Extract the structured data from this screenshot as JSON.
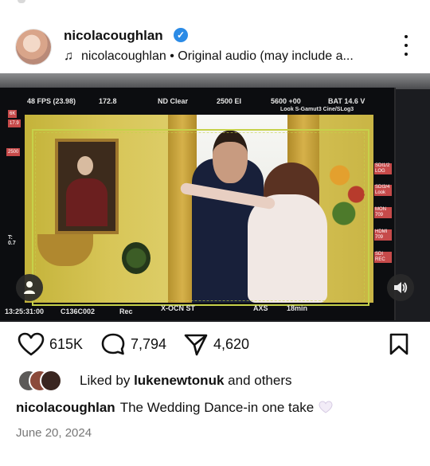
{
  "post": {
    "username": "nicolacoughlan",
    "audio_text": "nicolacoughlan • Original audio (may include a...",
    "likes": "615K",
    "comments": "7,794",
    "shares": "4,620",
    "liked_by_prefix": "Liked by",
    "liked_by_user": "lukenewtonuk",
    "liked_by_suffix": "and others",
    "caption_user": "nicolacoughlan",
    "caption_text": "The Wedding Dance-in one take",
    "date": "June 20, 2024"
  },
  "monitor": {
    "fps": "48 FPS (23.98)",
    "angle": "172.8",
    "nd": "ND Clear",
    "ei": "2500 EI",
    "wb": "5600 +00",
    "bat": "BAT 14.6 V",
    "look": "Look S-Gamut3 Cine/SLog3",
    "res": "6K",
    "res_num": "17.9",
    "iso_side": "2500",
    "t_stop": "T: 0.7",
    "timecode": "13:25:31:00",
    "clip": "C136C002",
    "rec": "Rec",
    "codec": "X-OCN ST",
    "media": "AXS",
    "remaining": "18min",
    "sdi12": "SDI1/2 LOG",
    "sdi34": "SDI3/4 Look",
    "mon": "MON 709",
    "hdmi": "HDMI 709",
    "sdirec": "SDI REC"
  },
  "colors": {
    "accent_verified": "#2b8be6",
    "text_primary": "#111111",
    "text_secondary": "#777777",
    "frame_line": "#c6d24a"
  },
  "icons": [
    "verified-icon",
    "music-note-icon",
    "more-options-icon",
    "heart-icon",
    "comment-icon",
    "share-icon",
    "bookmark-icon",
    "user-tag-icon",
    "sound-icon"
  ]
}
